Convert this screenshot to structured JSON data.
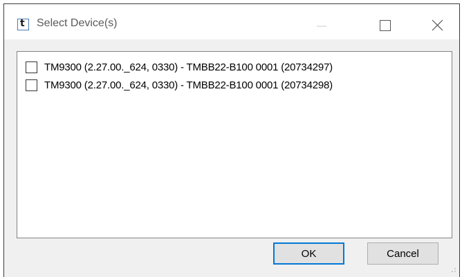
{
  "window": {
    "title": "Select Device(s)",
    "icon": "app-icon",
    "controls": {
      "minimize": "minimize-icon",
      "maximize": "maximize-icon",
      "close": "close-icon"
    }
  },
  "devices": {
    "items": [
      {
        "label": "TM9300 (2.27.00._624, 0330) - TMBB22-B100 0001 (20734297)",
        "checked": false
      },
      {
        "label": "TM9300 (2.27.00._624, 0330) - TMBB22-B100 0001 (20734298)",
        "checked": false
      }
    ]
  },
  "buttons": {
    "ok_label": "OK",
    "cancel_label": "Cancel"
  },
  "colors": {
    "focus_border": "#0078d7",
    "button_face": "#e1e1e1",
    "dialog_bg": "#f0f0f0"
  }
}
